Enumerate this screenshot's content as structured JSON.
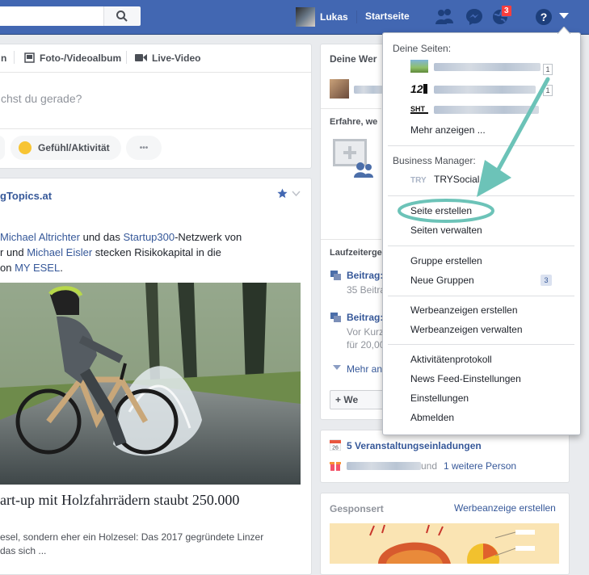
{
  "topbar": {
    "user_name": "Lukas",
    "home_label": "Startseite",
    "notification_count": "3"
  },
  "composer": {
    "tab_partial": "n",
    "photo_album": "Foto-/Videoalbum",
    "live_video": "Live-Video",
    "placeholder_partial": "chst du gerade?",
    "feeling_label": "Gefühl/Aktivität",
    "more_label": "•••"
  },
  "post": {
    "author_partial": "gTopics.at",
    "time_partial": "",
    "text_line1_a": "Michael Altrichter",
    "text_line1_b": " und das ",
    "text_line1_c": "Startup300",
    "text_line1_d": "-Netzwerk von",
    "text_line2_a": "r und ",
    "text_line2_b": "Michael Eisler",
    "text_line2_c": " stecken Risikokapital in die",
    "text_line3_a": "on ",
    "text_line3_b": "MY ESEL",
    "text_line3_c": ".",
    "headline": "art-up mit Holzfahrrädern staubt 250.000",
    "desc_line1": "esel, sondern eher ein Holzesel: Das 2017 gegründete Linzer",
    "desc_line2": "das sich ..."
  },
  "right_column": {
    "pages_title": "Deine Wer",
    "erfahre": "Erfahre, we",
    "laufzeit": "Laufzeitergeb",
    "beitrag1_title": "Beitrag:",
    "beitrag1_sub": "35 Beitra",
    "beitrag2_title": "Beitrag:",
    "beitrag2_sub1": "Vor Kurz",
    "beitrag2_sub2": "für 20,00",
    "mehr": "Mehr an",
    "weiter_button": "+ We"
  },
  "events": {
    "invites": "5 Veranstaltungseinladungen",
    "others_a": " und ",
    "others_b": "1 weitere Person"
  },
  "sponsored": {
    "title": "Gesponsert",
    "create_ad": "Werbeanzeige erstellen"
  },
  "menu": {
    "pages_header": "Deine Seiten:",
    "page_counts": [
      "1",
      "1"
    ],
    "show_more": "Mehr anzeigen ...",
    "bm_header": "Business Manager:",
    "bm_name": "TRYSocial",
    "create_page": "Seite erstellen",
    "manage_pages": "Seiten verwalten",
    "create_group": "Gruppe erstellen",
    "new_groups": "Neue Gruppen",
    "new_groups_count": "3",
    "create_ads": "Werbeanzeigen erstellen",
    "manage_ads": "Werbeanzeigen verwalten",
    "activity_log": "Aktivitätenprotokoll",
    "news_feed_settings": "News Feed-Einstellungen",
    "settings": "Einstellungen",
    "logout": "Abmelden"
  },
  "colors": {
    "brand": "#4267b2",
    "highlight_circle": "#6cc3b8",
    "link": "#365899"
  }
}
